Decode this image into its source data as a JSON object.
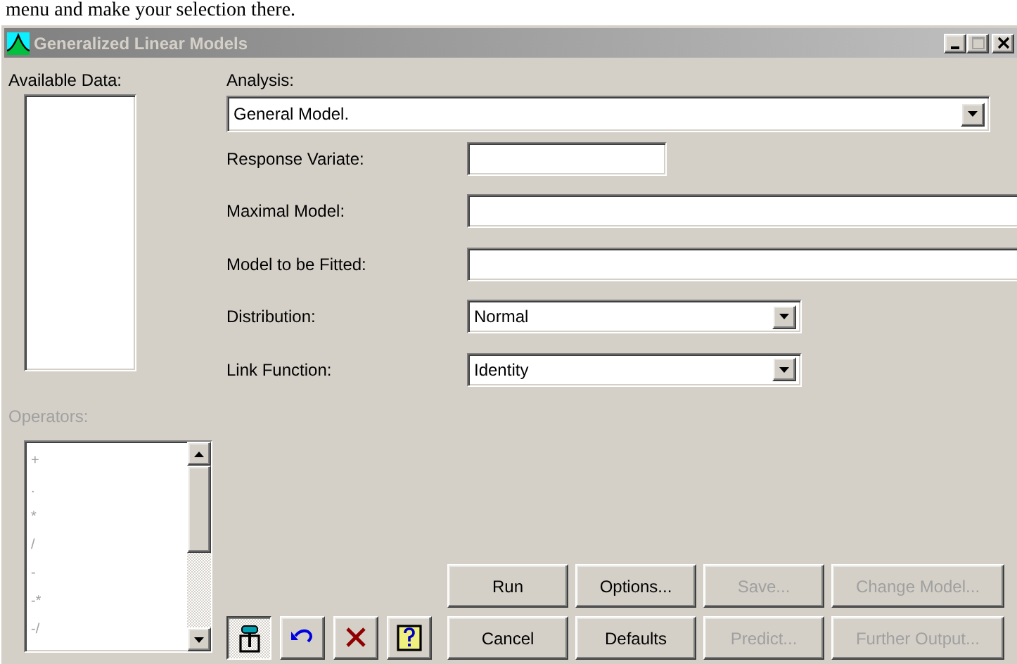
{
  "document_text": "menu and make your selection there.",
  "window": {
    "title": "Generalized Linear Models"
  },
  "available_data": {
    "label": "Available Data:"
  },
  "operators": {
    "label": "Operators:",
    "disabled": true,
    "items": [
      "+",
      ".",
      "*",
      "/",
      "-",
      "-*",
      "-/"
    ]
  },
  "analysis": {
    "label": "Analysis:",
    "value": "General Model."
  },
  "fields": [
    {
      "kind": "short_text",
      "label": "Response Variate:"
    },
    {
      "kind": "text",
      "label": "Maximal Model:"
    },
    {
      "kind": "text",
      "label": "Model to be Fitted:"
    },
    {
      "kind": "dropdown",
      "label": "Distribution:",
      "value": "Normal"
    },
    {
      "kind": "dropdown",
      "label": "Link Function:",
      "value": "Identity"
    }
  ],
  "tools": [
    {
      "kind": "pin",
      "pressed": true
    },
    {
      "kind": "undo",
      "pressed": false
    },
    {
      "kind": "clear",
      "pressed": false
    },
    {
      "kind": "help",
      "pressed": false
    }
  ],
  "buttons": [
    {
      "label": "Run",
      "disabled": false
    },
    {
      "label": "Options...",
      "disabled": false
    },
    {
      "label": "Save...",
      "disabled": true
    },
    {
      "label": "Change Model...",
      "disabled": true
    },
    {
      "label": "Cancel",
      "disabled": false
    },
    {
      "label": "Defaults",
      "disabled": false
    },
    {
      "label": "Predict...",
      "disabled": true
    },
    {
      "label": "Further Output...",
      "disabled": true
    }
  ]
}
